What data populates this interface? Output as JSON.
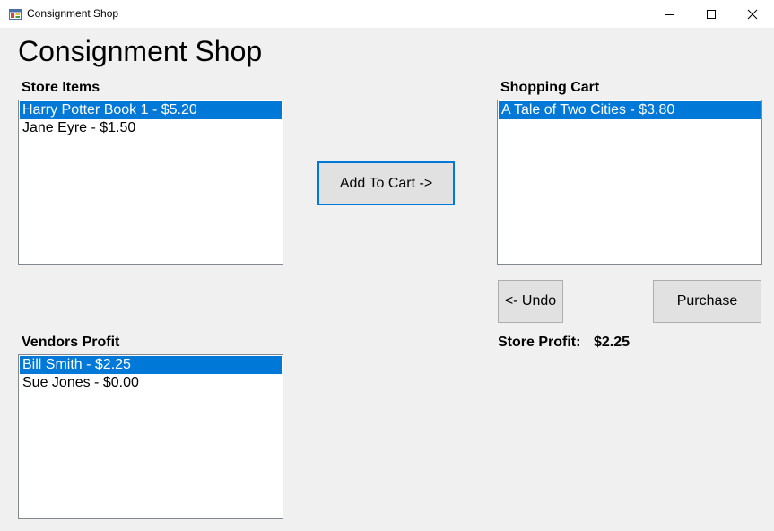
{
  "window": {
    "title": "Consignment Shop"
  },
  "header": {
    "title": "Consignment Shop"
  },
  "store_items": {
    "label": "Store Items",
    "items": [
      {
        "text": "Harry Potter Book 1 - $5.20",
        "selected": true
      },
      {
        "text": "Jane Eyre - $1.50",
        "selected": false
      }
    ]
  },
  "shopping_cart": {
    "label": "Shopping Cart",
    "items": [
      {
        "text": "A Tale of Two Cities - $3.80",
        "selected": true
      }
    ]
  },
  "vendors_profit": {
    "label": "Vendors Profit",
    "items": [
      {
        "text": "Bill Smith - $2.25",
        "selected": true
      },
      {
        "text": "Sue Jones - $0.00",
        "selected": false
      }
    ]
  },
  "buttons": {
    "add_to_cart": "Add To Cart ->",
    "undo": "<- Undo",
    "purchase": "Purchase"
  },
  "store_profit": {
    "label": "Store Profit:",
    "value": "$2.25"
  }
}
